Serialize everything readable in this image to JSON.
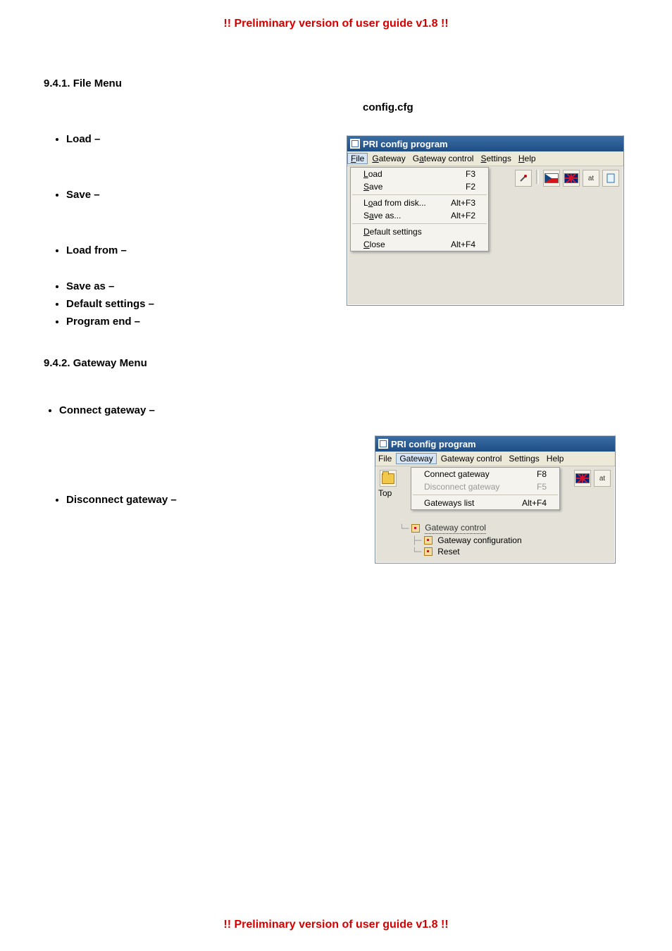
{
  "header_text": "!! Preliminary version of user guide v1.8 !!",
  "footer_text": "!! Preliminary version of user guide v1.8 !!",
  "section1_heading": "9.4.1.  File Menu",
  "filename_label": "config.cfg",
  "file_bullets": {
    "load": "Load –",
    "save": "Save –",
    "load_from": "Load   from  –",
    "save_as": "Save as –",
    "default_settings": "Default settings –",
    "program_end": "Program end –"
  },
  "section2_heading": "9.4.2.  Gateway Menu",
  "gateway_bullets": {
    "connect": "Connect gateway –",
    "disconnect": "Disconnect  gateway  –"
  },
  "win1": {
    "title": "PRI config program",
    "menubar": [
      "File",
      "Gateway",
      "Gateway control",
      "Settings",
      "Help"
    ],
    "file_menu": [
      {
        "label": "Load",
        "shortcut": "F3"
      },
      {
        "label": "Save",
        "shortcut": "F2"
      },
      {
        "sep": true
      },
      {
        "label": "Load from disk...",
        "shortcut": "Alt+F3"
      },
      {
        "label": "Save as...",
        "shortcut": "Alt+F2"
      },
      {
        "sep": true
      },
      {
        "label": "Default settings",
        "shortcut": ""
      },
      {
        "label": "Close",
        "shortcut": "Alt+F4"
      }
    ],
    "toolbar_at": "at"
  },
  "win2": {
    "title": "PRI config program",
    "menubar": [
      "File",
      "Gateway",
      "Gateway control",
      "Settings",
      "Help"
    ],
    "top_label": "Top",
    "gateway_menu": [
      {
        "label": "Connect gateway",
        "shortcut": "F8"
      },
      {
        "label": "Disconnect gateway",
        "shortcut": "F5",
        "disabled": true
      },
      {
        "sep": true
      },
      {
        "label": "Gateways list",
        "shortcut": "Alt+F4"
      }
    ],
    "tree": {
      "control": "Gateway control",
      "config": "Gateway configuration",
      "reset": "Reset"
    },
    "toolbar_at": "at"
  }
}
